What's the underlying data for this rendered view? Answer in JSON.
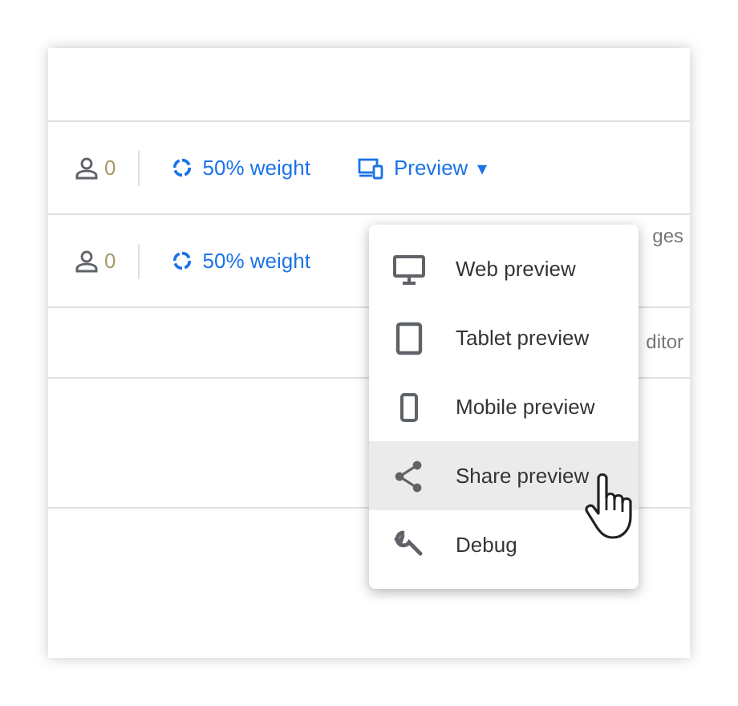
{
  "rows": [
    {
      "users": "0",
      "weight": "50% weight",
      "preview": {
        "label": "Preview",
        "caret": "▾"
      }
    },
    {
      "users": "0",
      "weight": "50% weight",
      "side_text": "ges"
    },
    {
      "side_text": "ditor"
    }
  ],
  "menu": {
    "items": [
      {
        "kind": "web",
        "label": "Web preview",
        "selected": false
      },
      {
        "kind": "tablet",
        "label": "Tablet preview",
        "selected": false
      },
      {
        "kind": "mobile",
        "label": "Mobile preview",
        "selected": false
      },
      {
        "kind": "share",
        "label": "Share preview",
        "selected": true
      },
      {
        "kind": "debug",
        "label": "Debug",
        "selected": false
      }
    ]
  }
}
